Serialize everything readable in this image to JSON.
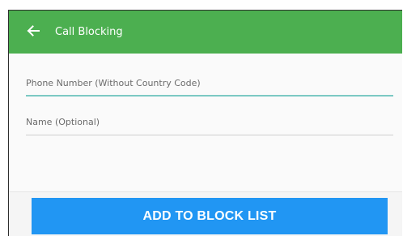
{
  "app_bar": {
    "title": "Call Blocking",
    "background_color": "#4caf50",
    "back_icon": "arrow-left-icon"
  },
  "form": {
    "phone_field": {
      "value": "",
      "placeholder": "Phone Number (Without Country Code)",
      "focused": true,
      "accent_color": "#7cc9c3"
    },
    "name_field": {
      "value": "",
      "placeholder": "Name (Optional)"
    }
  },
  "actions": {
    "add_button_label": "ADD TO BLOCK LIST",
    "button_color": "#2196f3"
  }
}
